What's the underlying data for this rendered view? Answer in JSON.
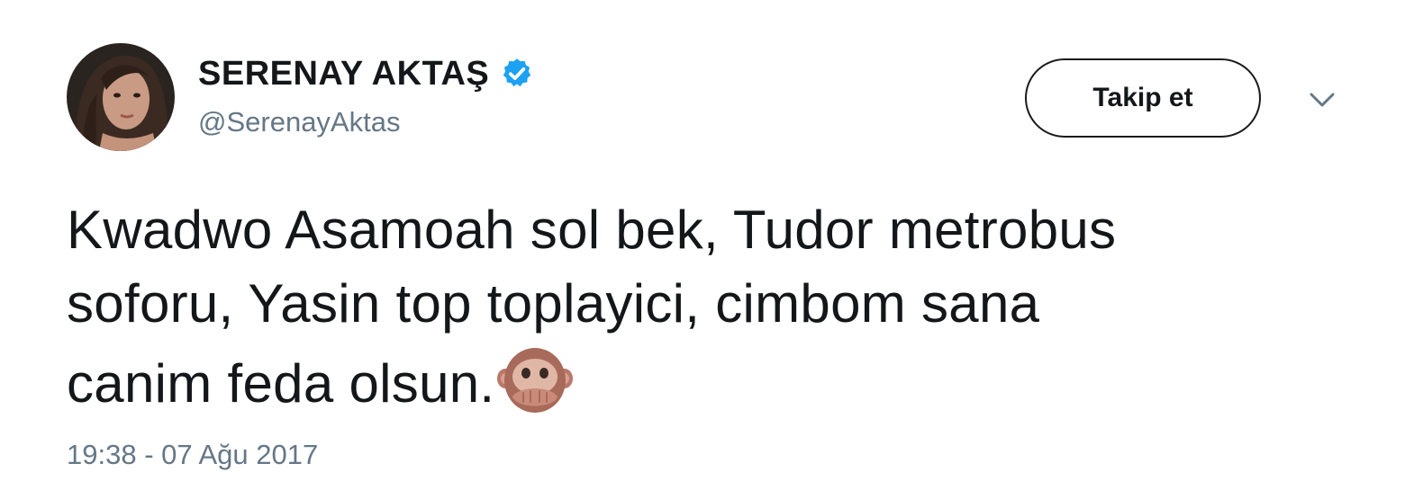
{
  "tweet": {
    "author": {
      "display_name": "SERENAY AKTAŞ",
      "handle": "@SerenayAktas",
      "verified_icon": "verified-badge-icon"
    },
    "follow_button_label": "Takip et",
    "more_icon": "chevron-down-icon",
    "text_lines": [
      "Kwadwo Asamoah sol bek, Tudor metrobus",
      "soforu, Yasin top toplayici, cimbom sana",
      "canim feda olsun."
    ],
    "emoji": "speak-no-evil-monkey",
    "timestamp": "19:38 - 07 Ağu 2017"
  },
  "colors": {
    "text_primary": "#14171a",
    "text_secondary": "#657786",
    "verified_blue": "#1da1f2",
    "button_border": "#1a1a1a"
  }
}
